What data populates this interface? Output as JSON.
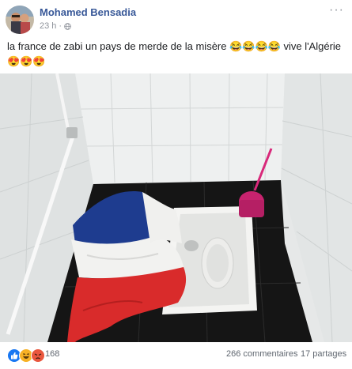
{
  "post": {
    "author": "Mohamed Bensadia",
    "time": "23 h",
    "text": "la france de zabi un pays de merde de la misère 😂😂😂😂 vive l'Algérie 😍😍😍"
  },
  "stats": {
    "reactions": [
      "like",
      "haha",
      "angry"
    ],
    "reaction_count": "168",
    "comments": "266 commentaires",
    "shares": "17 partages"
  },
  "colors": {
    "author_link": "#385898",
    "meta_grey": "#90949c",
    "like_blue": "#1877f2",
    "haha_yellow": "#f7b125",
    "angry_red": "#e9573e"
  }
}
